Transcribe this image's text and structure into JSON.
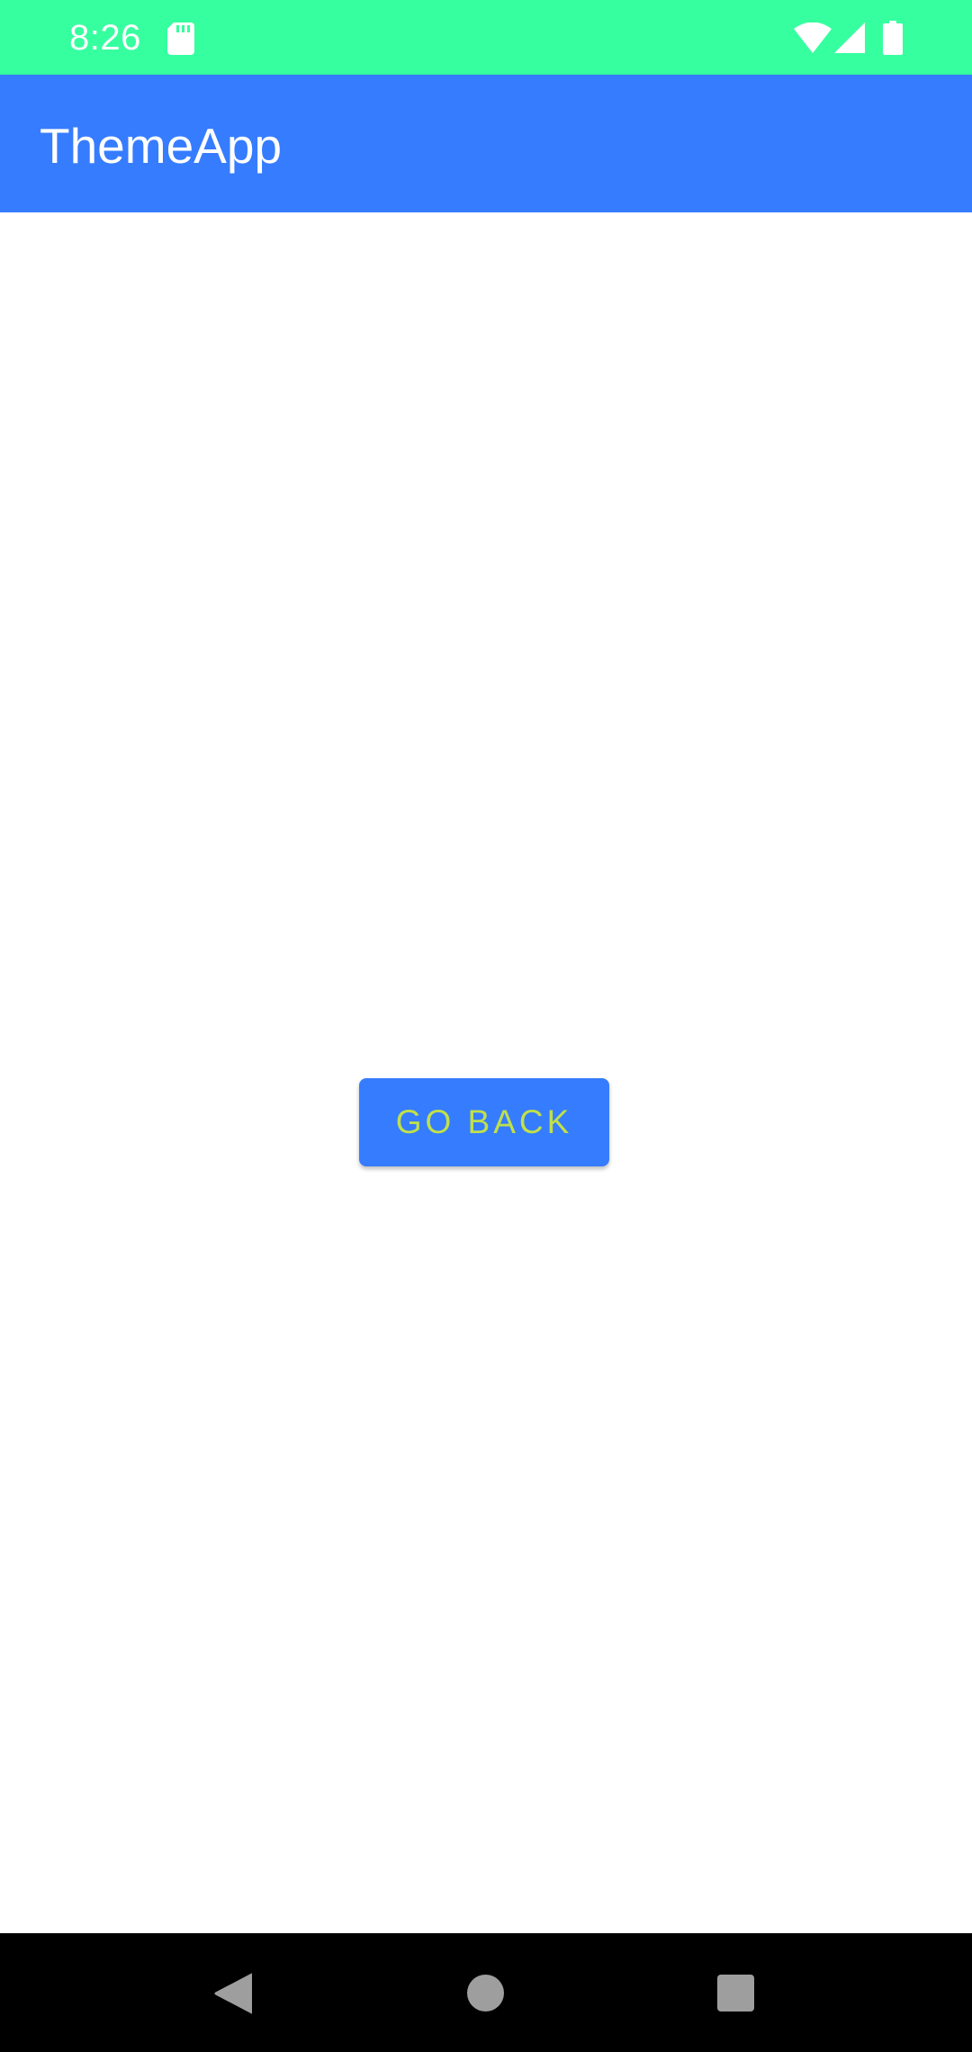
{
  "status_bar": {
    "time": "8:26",
    "icons": [
      "sd-card-icon",
      "wifi-icon",
      "cell-signal-icon",
      "battery-icon"
    ],
    "background_color": "#36ff9f"
  },
  "app_bar": {
    "title": "ThemeApp",
    "background_color": "#367cff"
  },
  "main": {
    "go_back_label": "GO BACK",
    "button_color": "#367cff",
    "button_text_color": "#c0e04a"
  },
  "nav_bar": {
    "buttons": [
      "back-icon",
      "home-icon",
      "recents-icon"
    ]
  }
}
